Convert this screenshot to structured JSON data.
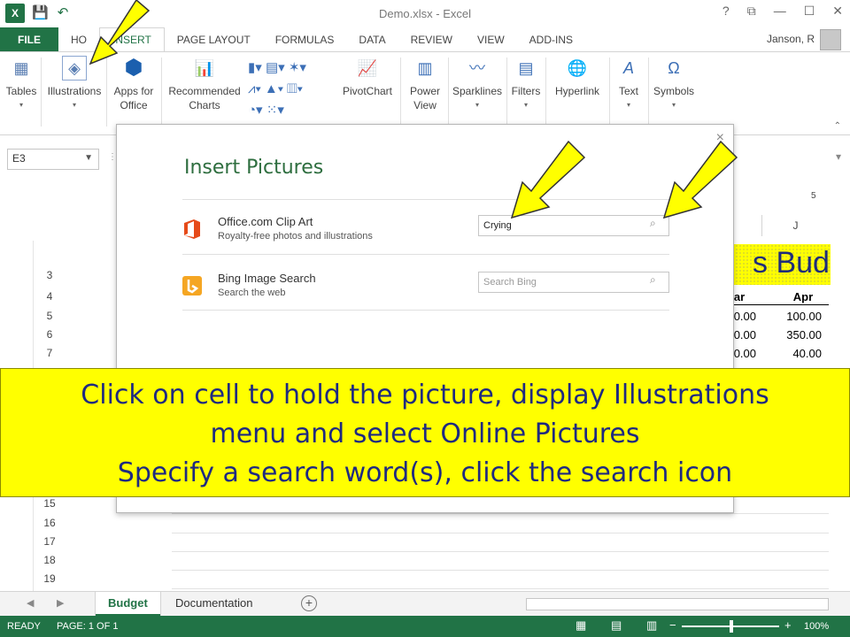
{
  "window": {
    "title": "Demo.xlsx - Excel",
    "app_badge": "X",
    "controls": [
      "?",
      "⧉",
      "—",
      "☐",
      "✕"
    ]
  },
  "tabs": [
    "FILE",
    "HOME",
    "INSERT",
    "PAGE LAYOUT",
    "FORMULAS",
    "DATA",
    "REVIEW",
    "VIEW",
    "ADD-INS"
  ],
  "tabs_visible_home": "HO",
  "user": "Janson, R",
  "ribbon": {
    "tables": "Tables",
    "illustrations": "Illustrations",
    "apps_line1": "Apps for",
    "apps_line2": "Office",
    "recommended_line1": "Recommended",
    "recommended_line2": "Charts",
    "pivotchart": "PivotChart",
    "power_line1": "Power",
    "power_line2": "View",
    "sparklines": "Sparklines",
    "filters": "Filters",
    "hyperlink": "Hyperlink",
    "text": "Text",
    "symbols": "Symbols"
  },
  "namebox": "E3",
  "sheet": {
    "rows": [
      "3",
      "4",
      "5",
      "6",
      "7",
      "15",
      "16",
      "17",
      "18",
      "19"
    ],
    "column_j": "J",
    "ruler_mark": "5",
    "title_fragment": "s Budg",
    "headers": [
      "ar",
      "Apr"
    ],
    "values": [
      [
        "0.00",
        "100.00"
      ],
      [
        "0.00",
        "350.00"
      ],
      [
        "0.00",
        "40.00"
      ]
    ]
  },
  "dialog": {
    "title": "Insert Pictures",
    "close": "×",
    "sources": [
      {
        "name": "Office.com Clip Art",
        "sub": "Royalty-free photos and illustrations",
        "value": "Crying",
        "placeholder": ""
      },
      {
        "name": "Bing Image Search",
        "sub": "Search the web",
        "value": "",
        "placeholder": "Search Bing"
      }
    ]
  },
  "callout": {
    "line1": "Click on cell to hold the picture, display Illustrations",
    "line2": "menu and select Online Pictures",
    "line3": "Specify a search word(s), click the search icon"
  },
  "sheet_tabs": [
    "Budget",
    "Documentation"
  ],
  "status": {
    "mode": "READY",
    "page": "PAGE: 1 OF 1",
    "zoom": "100%"
  },
  "colors": {
    "excel_green": "#217346",
    "callout_yellow": "#ffff00",
    "callout_text": "#1f2a80",
    "dialog_title": "#2e6e3f"
  }
}
